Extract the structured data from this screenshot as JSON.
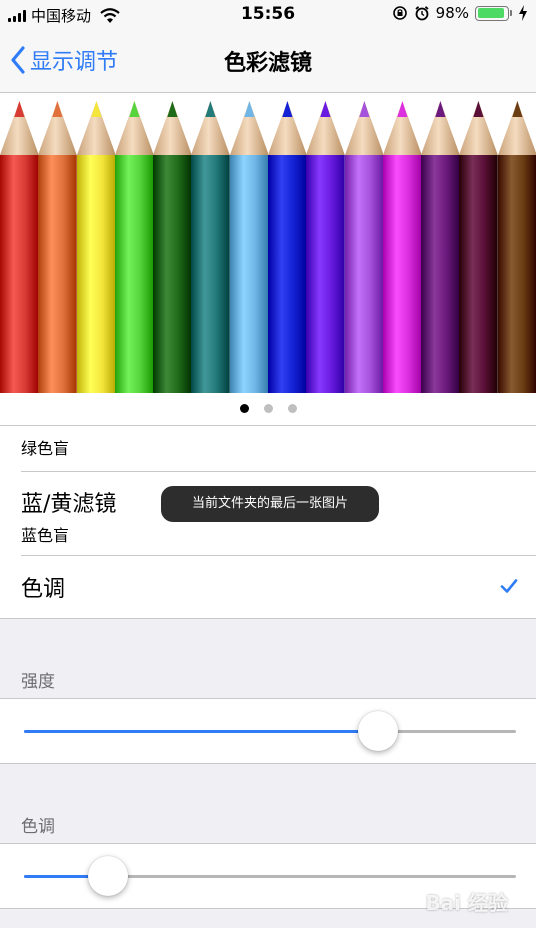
{
  "status_bar": {
    "carrier": "中国移动",
    "time": "15:56",
    "battery_percent": "98%",
    "battery_level": 0.98,
    "icons": [
      "signal-icon",
      "wifi-icon",
      "orientation-lock-icon",
      "alarm-icon",
      "battery-icon",
      "charging-icon"
    ]
  },
  "nav": {
    "back_label": "显示调节",
    "title": "色彩滤镜"
  },
  "carousel": {
    "pencil_colors": [
      "#d83a34",
      "#e0713d",
      "#f3e53a",
      "#55d43b",
      "#1f6b1a",
      "#237a7a",
      "#6fb6e6",
      "#1422d6",
      "#6a1be0",
      "#a552dc",
      "#dc2fe0",
      "#6c1a7d",
      "#5a1038",
      "#6b3d12"
    ],
    "page_count": 3,
    "active_page": 0,
    "dot_active_color": "#000000",
    "dot_inactive_color": "#bfbfbf"
  },
  "filters": {
    "partial_sub": "绿色盲",
    "blue_yellow_title": "蓝/黄滤镜",
    "blue_yellow_sub": "蓝色盲",
    "tint_title": "色调",
    "tint_checked": true
  },
  "toast": {
    "text": "当前文件夹的最后一张图片"
  },
  "intensity": {
    "header": "强度",
    "value": 0.72
  },
  "hue": {
    "header": "色调",
    "value": 0.17
  },
  "watermark": "Bai 经验",
  "colors": {
    "accent": "#2f7cf6",
    "background": "#efeff4",
    "separator": "#c8c7cc"
  }
}
